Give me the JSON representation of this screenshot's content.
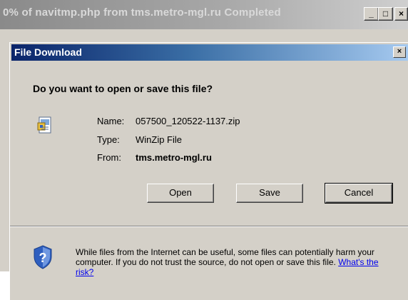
{
  "background_window": {
    "title": "0% of navitmp.php from tms.metro-mgl.ru Completed",
    "minimize_glyph": "_",
    "maximize_glyph": "□",
    "close_glyph": "×"
  },
  "dialog": {
    "title": "File Download",
    "close_glyph": "×",
    "question": "Do you want to open or save this file?",
    "file": {
      "name_label": "Name:",
      "name_value": "057500_120522-1137.zip",
      "type_label": "Type:",
      "type_value": "WinZip File",
      "from_label": "From:",
      "from_value": "tms.metro-mgl.ru",
      "icon": "zip-file-icon"
    },
    "buttons": {
      "open": "Open",
      "save": "Save",
      "cancel": "Cancel"
    },
    "warning": {
      "icon": "shield-question-icon",
      "text": "While files from the Internet can be useful, some files can potentially harm your computer. If you do not trust the source, do not open or save this file.",
      "link": "What's the risk?"
    }
  },
  "colors": {
    "dialog_face": "#d4d0c8",
    "active_title_start": "#0a246a",
    "active_title_end": "#a6caf0",
    "inactive_title": "#a8a8a8",
    "link": "#0000ee"
  }
}
